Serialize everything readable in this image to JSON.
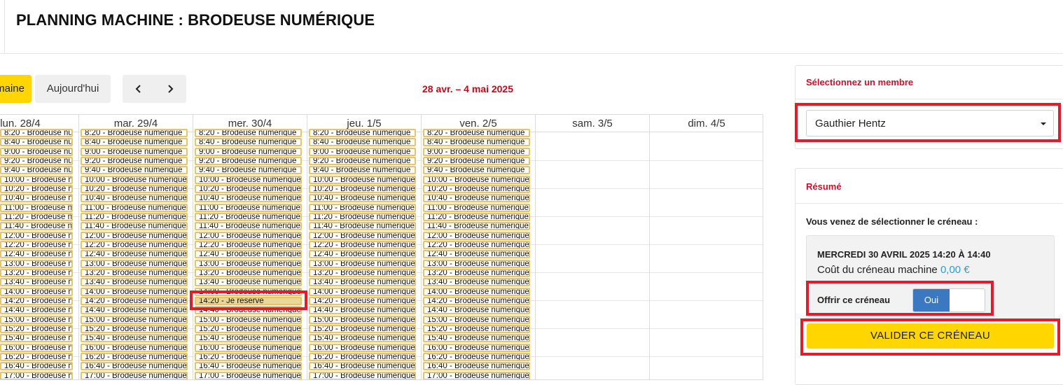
{
  "header": {
    "title": "PLANNING MACHINE : BRODEUSE NUMÉRIQUE"
  },
  "toolbar": {
    "week_label": "maine",
    "today_label": "Aujourd'hui",
    "prev_icon": "chevron-left-icon",
    "next_icon": "chevron-right-icon",
    "range_title": "28 avr. – 4 mai 2025"
  },
  "calendar": {
    "days": [
      "lun. 28/4",
      "mar. 29/4",
      "mer. 30/4",
      "jeu. 1/5",
      "ven. 2/5",
      "sam. 3/5",
      "dim. 4/5"
    ],
    "slot_label": "Brodeuse numérique",
    "reserve_label": "Je réserve",
    "times": [
      "8:20",
      "8:40",
      "9:00",
      "9:20",
      "9:40",
      "10:00",
      "10:20",
      "10:40",
      "11:00",
      "11:20",
      "11:40",
      "12:00",
      "12:20",
      "12:40",
      "13:00",
      "13:20",
      "13:40",
      "14:00",
      "14:20",
      "14:40",
      "15:00",
      "15:20",
      "15:40",
      "16:00",
      "16:20",
      "16:40",
      "17:00"
    ],
    "selected": {
      "day": "mer. 30/4",
      "time": "14:20"
    }
  },
  "member_panel": {
    "title": "Sélectionnez un membre",
    "selected_member": "Gauthier Hentz"
  },
  "summary_panel": {
    "title": "Résumé",
    "intro": "Vous venez de sélectionner le créneau :",
    "date_text": "MERCREDI 30 AVRIL 2025 14:20 À 14:40",
    "cost_label": "Coût du créneau machine",
    "cost_value": "0,00 €",
    "offer_label": "Offrir ce créneau",
    "toggle_on_label": "Oui",
    "validate_label": "VALIDER CE CRÉNEAU"
  },
  "colors": {
    "accent_yellow": "#ffd600",
    "title_red": "#c8102e",
    "highlight_red": "#e01e2b",
    "toggle_blue": "#3b78c2",
    "price_blue": "#2d9cdb",
    "slot_border": "#e5c56a"
  }
}
